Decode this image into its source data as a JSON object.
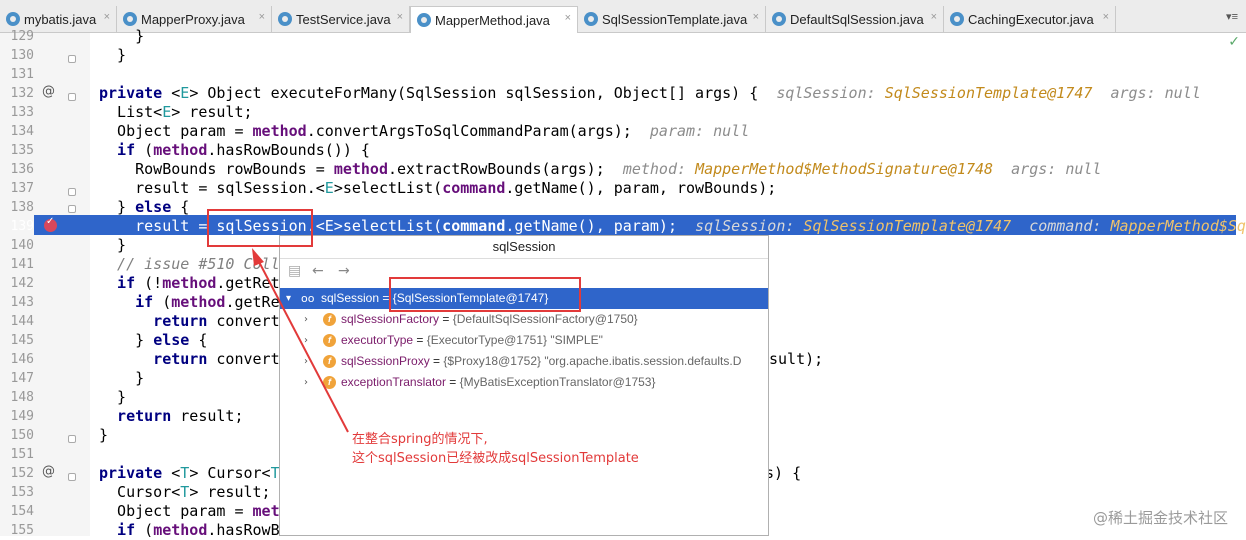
{
  "tabs": [
    {
      "label": "mybatis.java",
      "active": false
    },
    {
      "label": "MapperProxy.java",
      "active": false
    },
    {
      "label": "TestService.java",
      "active": false
    },
    {
      "label": "MapperMethod.java",
      "active": true
    },
    {
      "label": "SqlSessionTemplate.java",
      "active": false
    },
    {
      "label": "DefaultSqlSession.java",
      "active": false
    },
    {
      "label": "CachingExecutor.java",
      "active": false
    }
  ],
  "tab_close": "×",
  "tab_menu": "▾≡",
  "checkmark": "✓",
  "line_numbers": [
    "129",
    "130",
    "131",
    "132",
    "133",
    "134",
    "135",
    "136",
    "137",
    "138",
    "139",
    "140",
    "141",
    "142",
    "143",
    "144",
    "145",
    "146",
    "147",
    "148",
    "149",
    "150",
    "151",
    "152",
    "153",
    "154",
    "155"
  ],
  "gutter_marks": {
    "at": "@"
  },
  "code": {
    "l129": "    }",
    "l130": "  }",
    "l132_a": "private",
    "l132_b": " <",
    "l132_c": "E",
    "l132_d": "> Object executeForMany(SqlSession sqlSession, Object[] args) {  ",
    "l132_h1": "sqlSession: ",
    "l132_v1": "SqlSessionTemplate@1747",
    "l132_h2": "  args: null",
    "l133_a": "  List<",
    "l133_b": "E",
    "l133_c": "> result;",
    "l134_a": "  Object param = ",
    "l134_b": "method",
    "l134_c": ".convertArgsToSqlCommandParam(args);  ",
    "l134_h": "param: null",
    "l135_a": "  if",
    "l135_b": " (",
    "l135_c": "method",
    "l135_d": ".hasRowBounds()) {",
    "l136_a": "    RowBounds rowBounds = ",
    "l136_b": "method",
    "l136_c": ".extractRowBounds(args);  ",
    "l136_h1": "method: ",
    "l136_v1": "MapperMethod$MethodSignature@1748",
    "l136_h2": "  args: null",
    "l137_a": "    result = sqlSession.<",
    "l137_b": "E",
    "l137_c": ">selectList(",
    "l137_d": "command",
    "l137_e": ".getName(), param, rowBounds);",
    "l138_a": "  } ",
    "l138_b": "else",
    "l138_c": " {",
    "l139_a": "    result = sqlSession.<E>selectList(",
    "l139_b": "command",
    "l139_c": ".getName(), param);  ",
    "l139_h1": "sqlSession: ",
    "l139_v1": "SqlSessionTemplate@1747",
    "l139_h2": "  command: ",
    "l139_v2": "MapperMethod$SqlC",
    "l140": "  }",
    "l141": "  // issue #510 Coll",
    "l142_a": "  if",
    "l142_b": " (!",
    "l142_c": "method",
    "l142_d": ".getRet",
    "l143_a": "    if",
    "l143_b": " (",
    "l143_c": "method",
    "l143_d": ".getRe",
    "l144_a": "      return",
    "l144_b": " convert",
    "l145_a": "    } ",
    "l145_b": "else",
    "l145_c": " {",
    "l146_a": "      return",
    "l146_b": " convert",
    "l146_tail": "sult);",
    "l147": "    }",
    "l148": "  }",
    "l149_a": "  return",
    "l149_b": " result;",
    "l150": "}",
    "l152_a": "private",
    "l152_b": " <",
    "l152_c": "T",
    "l152_d": "> Cursor<",
    "l152_e": "T",
    "l152_tail": "s) {",
    "l153_a": "  Cursor<",
    "l153_b": "T",
    "l153_c": "> result;",
    "l154_a": "  Object param = ",
    "l154_b": "met",
    "l155_a": "  if",
    "l155_b": " (",
    "l155_c": "method",
    "l155_d": ".hasRowB"
  },
  "popup": {
    "title": "sqlSession",
    "back": "←",
    "forward": "→",
    "rows": [
      {
        "arrow": "▾",
        "name": "sqlSession",
        "eq": " = ",
        "value": "{SqlSessionTemplate@1747}",
        "selected": true
      },
      {
        "arrow": "›",
        "badge": "f",
        "name": "sqlSessionFactory",
        "eq": " = ",
        "value": "{DefaultSqlSessionFactory@1750}"
      },
      {
        "arrow": "›",
        "badge": "f",
        "name": "executorType",
        "eq": " = ",
        "value": "{ExecutorType@1751} \"SIMPLE\""
      },
      {
        "arrow": "›",
        "badge": "f",
        "name": "sqlSessionProxy",
        "eq": " = ",
        "value": "{$Proxy18@1752} \"org.apache.ibatis.session.defaults.D"
      },
      {
        "arrow": "›",
        "badge": "f",
        "name": "exceptionTranslator",
        "eq": " = ",
        "value": "{MyBatisExceptionTranslator@1753}"
      }
    ]
  },
  "annotation": {
    "line1": "在整合spring的情况下,",
    "line2": "这个sqlSession已经被改成sqlSessionTemplate"
  },
  "watermark": "@稀土掘金技术社区",
  "colors": {
    "selection": "#2f65ca",
    "annotation": "#e23a3a",
    "breakpoint": "#d9475c"
  }
}
